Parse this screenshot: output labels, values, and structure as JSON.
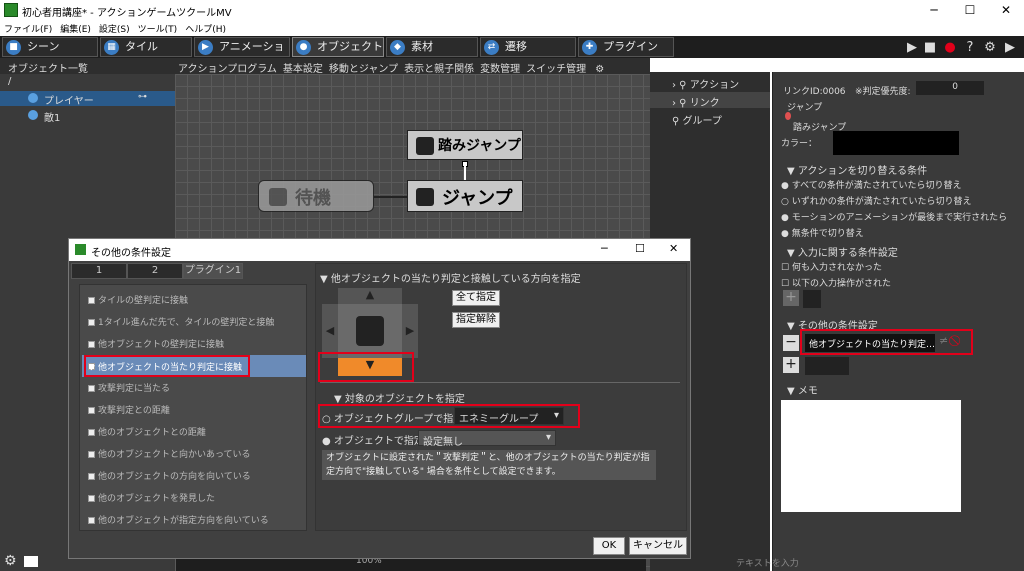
{
  "window": {
    "title": "初心者用講座* - アクションゲームツクールMV",
    "minimize": "─",
    "maximize": "☐",
    "close": "✕"
  },
  "menu": [
    "ファイル(F)",
    "編集(E)",
    "設定(S)",
    "ツール(T)",
    "ヘルプ(H)"
  ],
  "tabs": [
    "シーン",
    "タイル",
    "アニメーション",
    "オブジェクト",
    "素材",
    "遷移",
    "プラグイン"
  ],
  "left": {
    "header": "オブジェクト一覧",
    "root": "/",
    "items": [
      "プレイヤー",
      "敵1"
    ]
  },
  "center": {
    "tabs": [
      "アクションプログラム",
      "基本設定",
      "移動とジャンプ",
      "表示と親子関係",
      "変数管理",
      "スイッチ管理"
    ],
    "nodes": {
      "stomp": "踏みジャンプ",
      "idle": "待機",
      "jump": "ジャンプ"
    }
  },
  "mid": {
    "items": [
      "アクション",
      "リンク",
      "グループ"
    ]
  },
  "right": {
    "link_id": "リンクID:0006",
    "priority_label": "※判定優先度:",
    "priority_value": "0",
    "from": "ジャンプ",
    "to": "踏みジャンプ",
    "color_label": "カラー：",
    "switch_header": "アクションを切り替える条件",
    "switch_options": [
      "すべての条件が満たされていたら切り替え",
      "いずれかの条件が満たされていたら切り替え",
      "モーションのアニメーションが最後まで実行されたら",
      "無条件で切り替え"
    ],
    "input_header": "入力に関する条件設定",
    "input_options": [
      "何も入力されなかった",
      "以下の入力操作がされた"
    ],
    "other_header": "その他の条件設定",
    "other_item": "他オブジェクトの当たり判定…",
    "memo_header": "メモ"
  },
  "dialog": {
    "title": "その他の条件設定",
    "tabs": [
      "1",
      "2",
      "プラグイン1"
    ],
    "conditions": [
      "タイルの壁判定に接触",
      "1タイル進んだ先で、タイルの壁判定と接触",
      "他オブジェクトの壁判定に接触",
      "他オブジェクトの当たり判定に接触",
      "攻撃判定に当たる",
      "攻撃判定との距離",
      "他のオブジェクトとの距離",
      "他のオブジェクトと向かいあっている",
      "他のオブジェクトの方向を向いている",
      "他のオブジェクトを発見した",
      "他のオブジェクトが指定方向を向いている"
    ],
    "direction_header": "他オブジェクトの当たり判定と接触している方向を指定",
    "select_all": "全て指定",
    "clear": "指定解除",
    "target_header": "対象のオブジェクトを指定",
    "group_label": "オブジェクトグループで指定",
    "group_value": "エネミーグループ",
    "object_label": "オブジェクトで指定",
    "object_value": "設定無し",
    "description": "オブジェクトに設定された＂攻撃判定＂と、他のオブジェクトの当たり判定が指定方向で\"接触している\" 場合を条件として設定できます。",
    "ok": "OK",
    "cancel": "キャンセル"
  },
  "bottom": {
    "text_input": "テキストを入力",
    "zoom": "100%"
  },
  "colors": {
    "accent_red": "#e2001a",
    "selected_blue": "#2a5a8a",
    "orange": "#f08a2a"
  }
}
